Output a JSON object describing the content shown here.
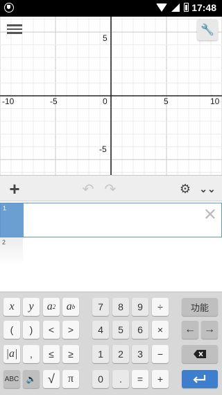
{
  "status_bar": {
    "time": "17:48",
    "shield_icon": "shield-icon",
    "wifi_icon": "wifi-icon",
    "signal_icon": "signal-icon",
    "battery_icon": "battery-icon"
  },
  "graph": {
    "menu_icon": "hamburger-menu-icon",
    "settings_icon": "wrench-icon",
    "x_axis_labels": [
      "-10",
      "-5",
      "0",
      "5",
      "10"
    ],
    "y_axis_labels": [
      "5",
      "-5"
    ],
    "xlim": [
      -10,
      10
    ],
    "ylim": [
      -6.2,
      6.2
    ],
    "grid": true
  },
  "toolbar": {
    "add_label": "+",
    "undo_label": "↶",
    "redo_label": "↷",
    "settings_label": "⚙",
    "collapse_label": "⌄⌄"
  },
  "expressions": [
    {
      "index": "1",
      "value": "",
      "close_label": "✕"
    },
    {
      "index": "2",
      "value": ""
    }
  ],
  "keypad": {
    "functions_label": "功能",
    "left_arrow": "←",
    "right_arrow": "→",
    "backspace_icon": "backspace-icon",
    "enter_icon": "enter-icon",
    "speaker_icon": "speaker-icon",
    "keys": {
      "x": "x",
      "y": "y",
      "a2": "a",
      "a2_sup": "2",
      "ab": "a",
      "ab_sup": "b",
      "lparen": "(",
      "rparen": ")",
      "lt": "<",
      "gt": ">",
      "abs": "|a|",
      "comma": ",",
      "le": "≤",
      "ge": "≥",
      "abc": "ABC",
      "sqrt": "√",
      "pi": "π",
      "n7": "7",
      "n8": "8",
      "n9": "9",
      "div": "÷",
      "n4": "4",
      "n5": "5",
      "n6": "6",
      "mul": "×",
      "n1": "1",
      "n2": "2",
      "n3": "3",
      "minus": "−",
      "n0": "0",
      "dot": ".",
      "eq": "=",
      "plus": "+"
    }
  }
}
